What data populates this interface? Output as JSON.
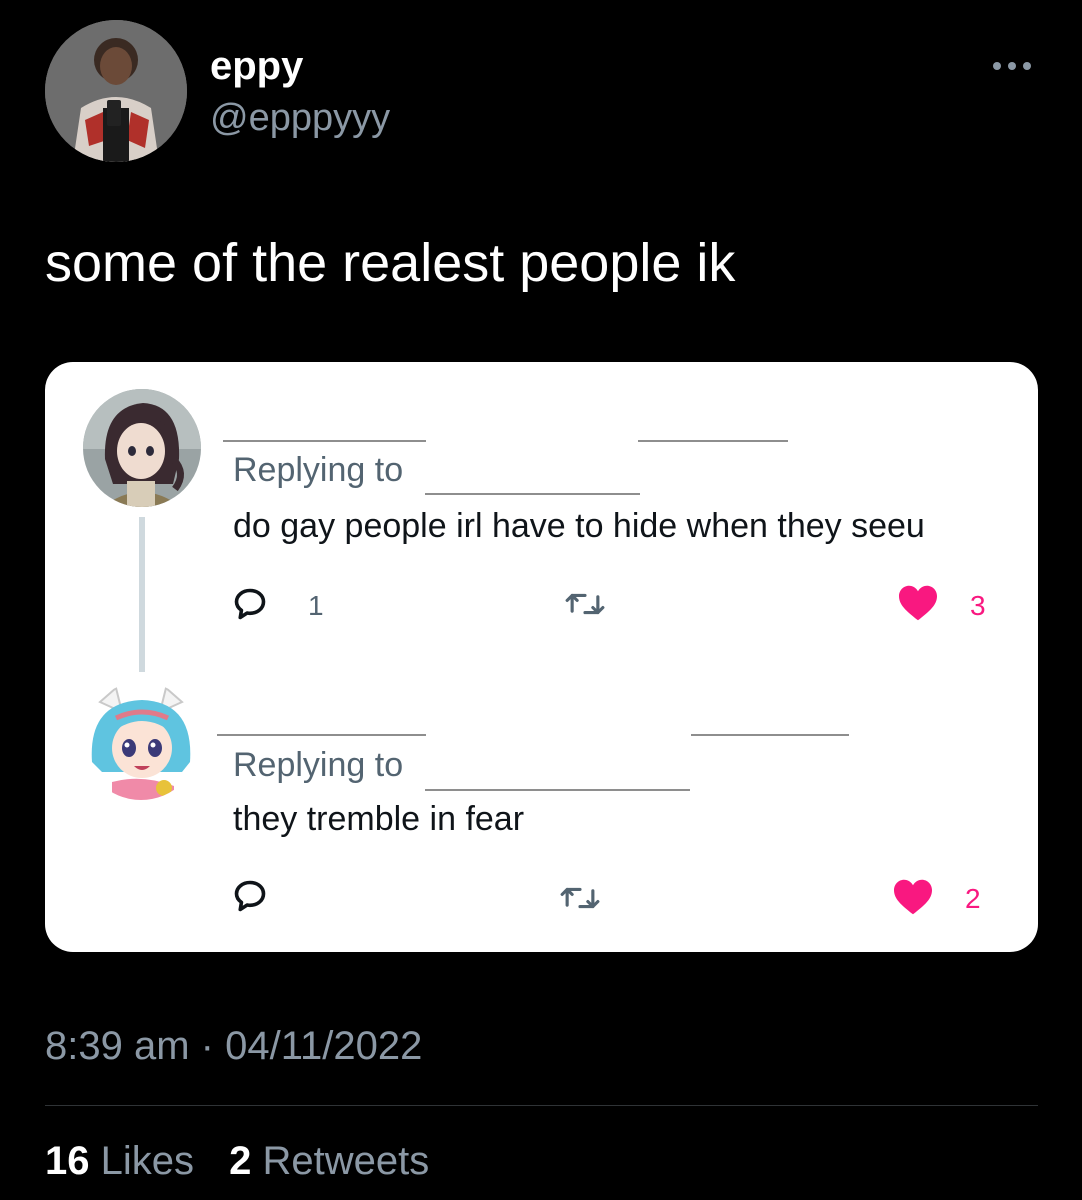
{
  "author": {
    "display_name": "eppy",
    "handle": "@epppyyy",
    "avatar_icon": "profile-photo"
  },
  "tweet": {
    "text": "some of the realest people ik",
    "time": "8:39 am",
    "separator": "·",
    "date": "04/11/2022"
  },
  "screenshot_card": {
    "replies": [
      {
        "avatar_icon": "anime-girl-dark-hair-avatar",
        "replying_label": "Replying to",
        "text": "do gay people irl have to hide when they seeu",
        "reply_count": "1",
        "retweet_count": "",
        "like_count": "3"
      },
      {
        "avatar_icon": "anime-girl-blue-hair-avatar",
        "replying_label": "Replying to",
        "text": "they tremble in fear",
        "reply_count": "",
        "retweet_count": "",
        "like_count": "2"
      }
    ]
  },
  "stats": {
    "likes_count": "16",
    "likes_label": "Likes",
    "retweets_count": "2",
    "retweets_label": "Retweets"
  },
  "colors": {
    "background": "#000000",
    "handle_grey": "#8b98a5",
    "like_pink": "#f91880",
    "icon_grey": "#536471"
  }
}
